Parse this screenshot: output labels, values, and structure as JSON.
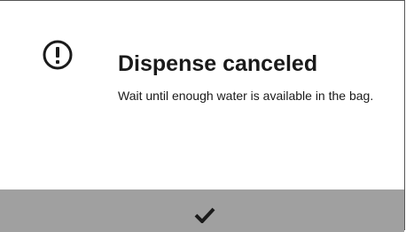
{
  "dialog": {
    "title": "Dispense canceled",
    "message": "Wait until enough water is available in the bag.",
    "alert_icon": "exclamation-circle-icon",
    "confirm_icon": "checkmark-icon"
  },
  "colors": {
    "confirm_bar": "#a0a0a0",
    "text": "#1a1a1a",
    "border": "#555555"
  }
}
